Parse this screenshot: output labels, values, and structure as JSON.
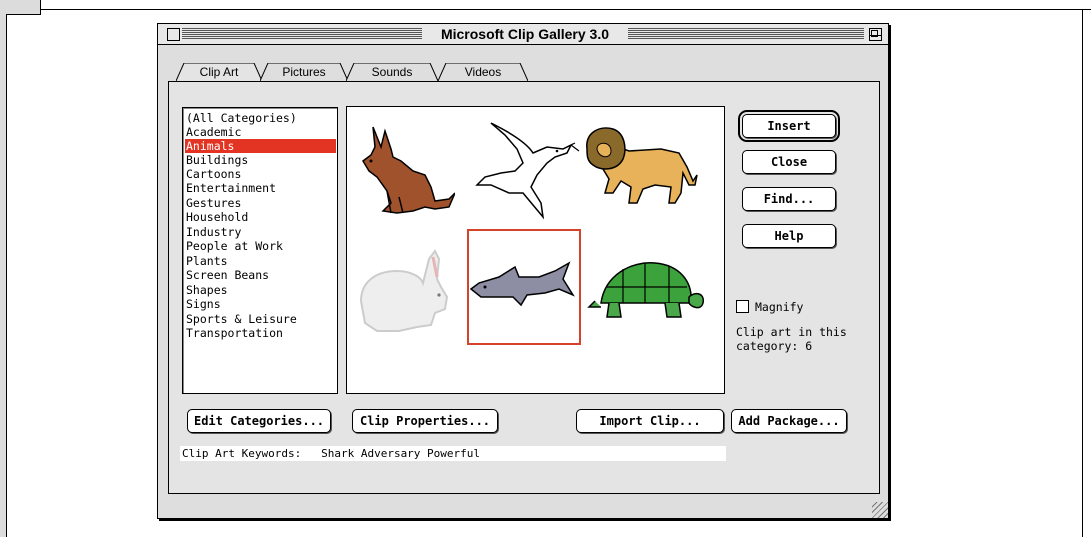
{
  "window": {
    "title": "Microsoft Clip Gallery 3.0"
  },
  "tabs": [
    {
      "label": "Clip Art",
      "selected": true
    },
    {
      "label": "Pictures",
      "selected": false
    },
    {
      "label": "Sounds",
      "selected": false
    },
    {
      "label": "Videos",
      "selected": false
    }
  ],
  "categories": [
    {
      "label": "(All Categories)",
      "selected": false
    },
    {
      "label": "Academic",
      "selected": false
    },
    {
      "label": "Animals",
      "selected": true
    },
    {
      "label": "Buildings",
      "selected": false
    },
    {
      "label": "Cartoons",
      "selected": false
    },
    {
      "label": "Entertainment",
      "selected": false
    },
    {
      "label": "Gestures",
      "selected": false
    },
    {
      "label": "Household",
      "selected": false
    },
    {
      "label": "Industry",
      "selected": false
    },
    {
      "label": "People at Work",
      "selected": false
    },
    {
      "label": "Plants",
      "selected": false
    },
    {
      "label": "Screen Beans",
      "selected": false
    },
    {
      "label": "Shapes",
      "selected": false
    },
    {
      "label": "Signs",
      "selected": false
    },
    {
      "label": "Sports & Leisure",
      "selected": false
    },
    {
      "label": "Transportation",
      "selected": false
    }
  ],
  "clips": [
    {
      "name": "donkey",
      "selected": false
    },
    {
      "name": "dove",
      "selected": false
    },
    {
      "name": "lion",
      "selected": false
    },
    {
      "name": "rabbit",
      "selected": false
    },
    {
      "name": "shark",
      "selected": true
    },
    {
      "name": "turtle",
      "selected": false
    }
  ],
  "side_buttons": {
    "insert": "Insert",
    "close": "Close",
    "find": "Find...",
    "help": "Help"
  },
  "magnify": {
    "label": "Magnify",
    "checked": false
  },
  "count_text": {
    "line1": "Clip art in this",
    "line2": "category: 6"
  },
  "bottom_buttons": {
    "edit_categories": "Edit Categories...",
    "clip_properties": "Clip Properties...",
    "import_clip": "Import Clip...",
    "add_package": "Add Package..."
  },
  "keywords": {
    "label": "Clip Art Keywords:",
    "value": "Shark Adversary Powerful"
  },
  "colors": {
    "selection": "#e33322",
    "clip_highlight": "#d7422c",
    "window_bg": "#dedede"
  }
}
